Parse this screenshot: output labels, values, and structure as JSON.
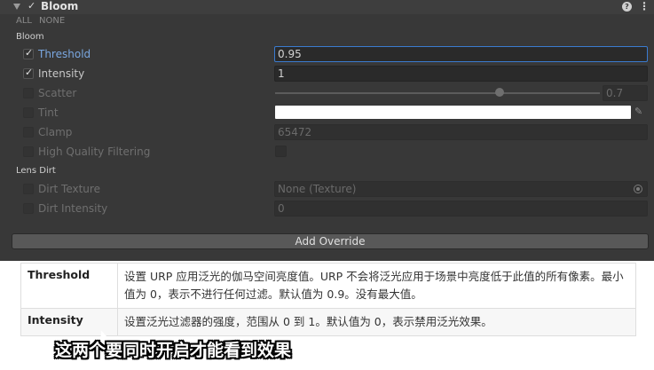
{
  "component": {
    "title": "Bloom",
    "enabled_mark": "✓",
    "help_icon": "?",
    "menu_icon": "⋮",
    "all_label": "ALL",
    "none_label": "NONE"
  },
  "sections": {
    "bloom": "Bloom",
    "lens_dirt": "Lens Dirt"
  },
  "properties": {
    "threshold": {
      "label": "Threshold",
      "value": "0.95",
      "override": true
    },
    "intensity": {
      "label": "Intensity",
      "value": "1",
      "override": true
    },
    "scatter": {
      "label": "Scatter",
      "value": "0.7",
      "slider_fraction": 0.7,
      "override": false
    },
    "tint": {
      "label": "Tint",
      "color": "#FFFFFF",
      "override": false
    },
    "clamp": {
      "label": "Clamp",
      "value": "65472",
      "override": false
    },
    "high_quality": {
      "label": "High Quality Filtering",
      "override": false
    },
    "dirt_texture": {
      "label": "Dirt Texture",
      "value": "None (Texture)",
      "override": false
    },
    "dirt_intensity": {
      "label": "Dirt Intensity",
      "value": "0",
      "override": false
    }
  },
  "add_override_label": "Add Override",
  "doc_table": {
    "rows": [
      {
        "name": "Threshold",
        "desc": "设置 URP 应用泛光的伽马空间亮度值。URP 不会将泛光应用于场景中亮度低于此值的所有像素。最小值为 0，表示不进行任何过滤。默认值为 0.9。没有最大值。"
      },
      {
        "name": "Intensity",
        "desc": "设置泛光过滤器的强度，范围从 0 到 1。默认值为 0，表示禁用泛光效果。"
      }
    ]
  },
  "subtitle": "这两个要同时开启才能看到效果",
  "colors": {
    "panel_bg": "#383838",
    "field_bg": "#2a2a2a",
    "accent_blue": "#7aa7e0",
    "tint": "#FFFFFF"
  }
}
